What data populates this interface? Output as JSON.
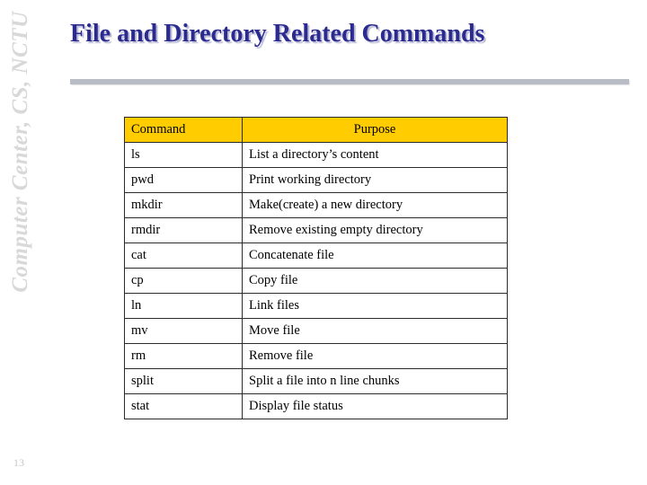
{
  "sidebar": {
    "label": "Computer Center, CS, NCTU"
  },
  "slide": {
    "title": "File and Directory Related Commands",
    "page_number": "13"
  },
  "table": {
    "headers": [
      "Command",
      "Purpose"
    ],
    "rows": [
      [
        "ls",
        "List a directory’s content"
      ],
      [
        "pwd",
        "Print working directory"
      ],
      [
        "mkdir",
        "Make(create) a new directory"
      ],
      [
        "rmdir",
        "Remove existing empty directory"
      ],
      [
        "cat",
        "Concatenate file"
      ],
      [
        "cp",
        "Copy file"
      ],
      [
        "ln",
        "Link files"
      ],
      [
        "mv",
        "Move file"
      ],
      [
        "rm",
        "Remove file"
      ],
      [
        "split",
        "Split a file into n line chunks"
      ],
      [
        "stat",
        "Display file status"
      ]
    ]
  },
  "colors": {
    "header_bg": "#ffcc00",
    "title": "#2b2b8f",
    "sidebar_text": "#d8d8d8",
    "rule": "#b8bcc4"
  }
}
